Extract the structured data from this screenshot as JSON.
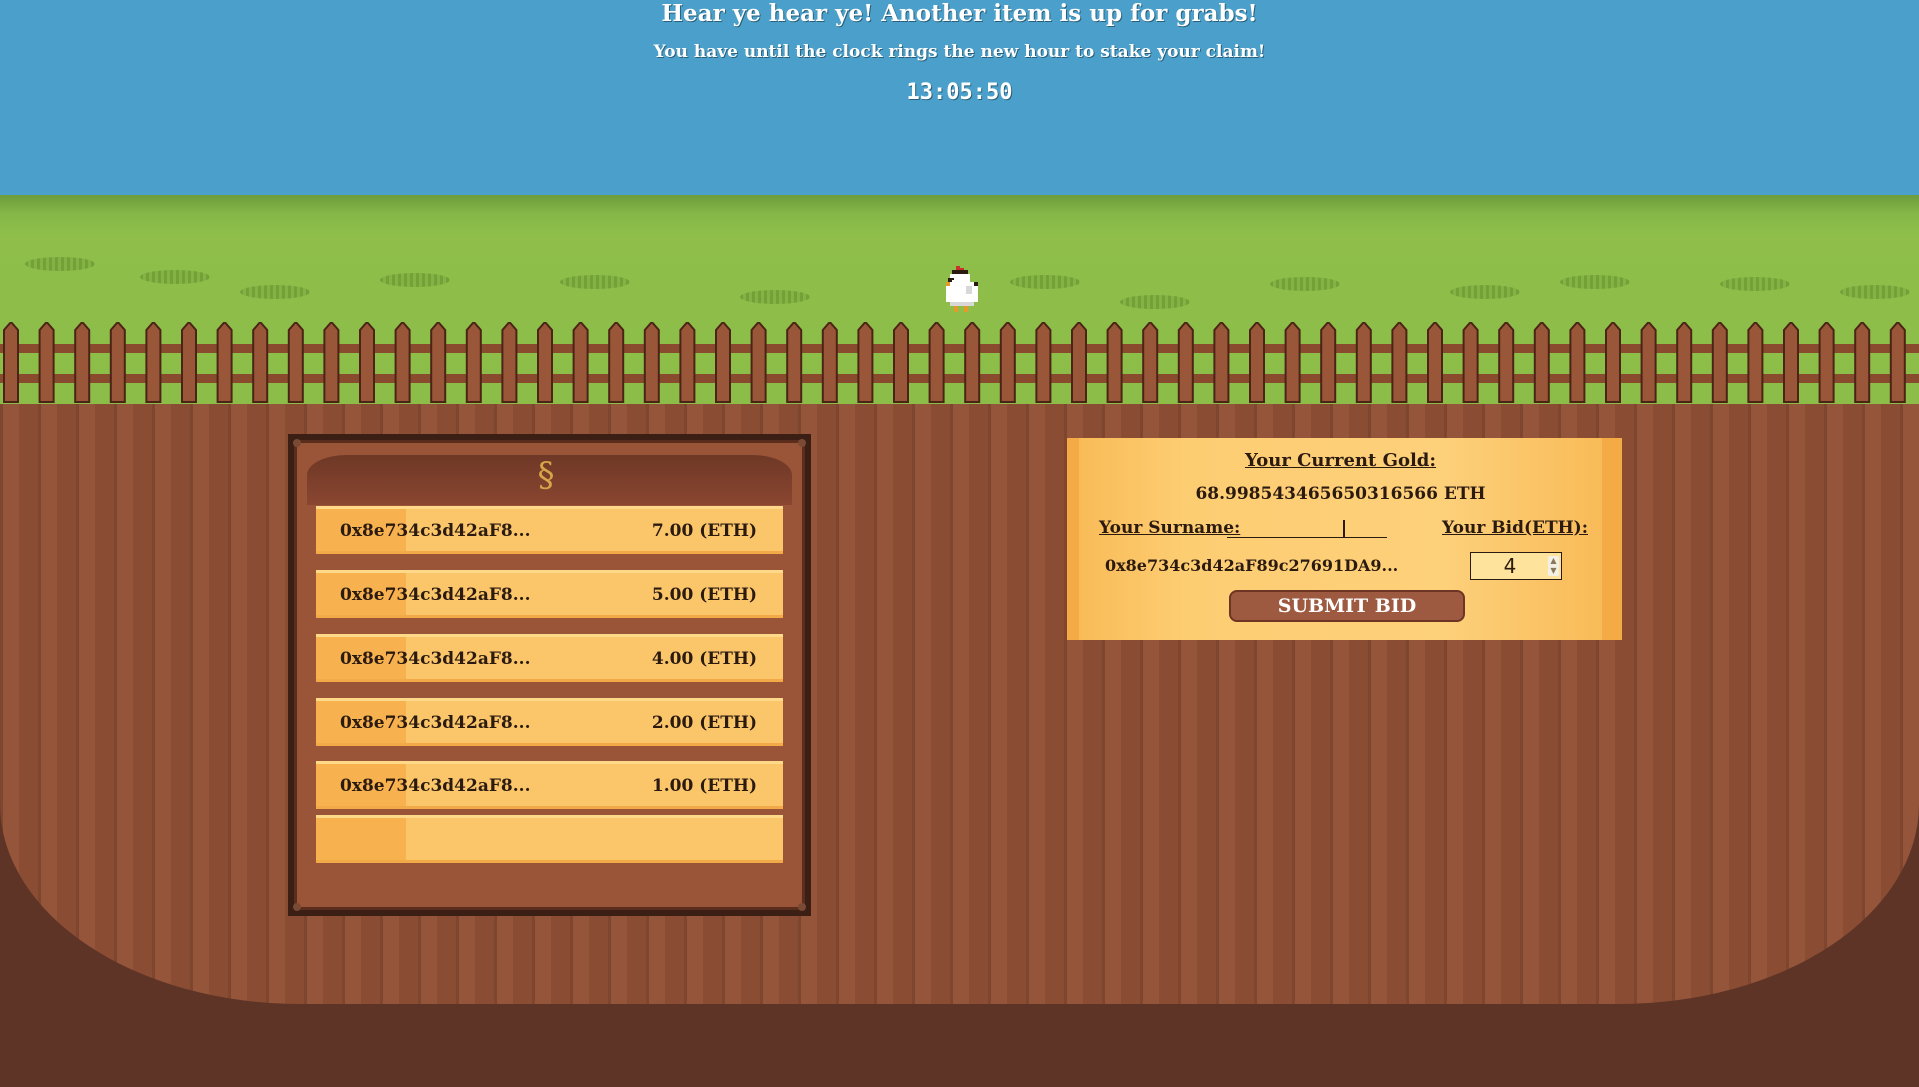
{
  "header": {
    "title": "Hear ye hear ye! Another item is up for grabs!",
    "subtitle": "You have until the clock rings the new hour to stake your claim!",
    "clock": "13:05:50"
  },
  "bids": [
    {
      "address": "0x8e734c3d42aF8...",
      "amount": "7.00 (ETH)"
    },
    {
      "address": "0x8e734c3d42aF8...",
      "amount": "5.00 (ETH)"
    },
    {
      "address": "0x8e734c3d42aF8...",
      "amount": "4.00 (ETH)"
    },
    {
      "address": "0x8e734c3d42aF8...",
      "amount": "2.00 (ETH)"
    },
    {
      "address": "0x8e734c3d42aF8...",
      "amount": "1.00 (ETH)"
    },
    {
      "address": "",
      "amount": ""
    }
  ],
  "panel": {
    "gold_label": "Your Current Gold:",
    "gold_value": "68.99854346565031656​6 ETH",
    "surname_label": "Your Surname:",
    "bid_label": "Your Bid(ETH):",
    "surname_value": "0x8e734c3d42aF89c27691DA9...",
    "bid_value": "4",
    "submit_label": "SUBMIT BID"
  },
  "colors": {
    "sky": "#4aa0ca",
    "grass": "#8cbd48",
    "dirt": "#94553a",
    "scroll": "#fcc56a",
    "button": "#9e5a40"
  },
  "icons": {
    "mascot": "chicken-icon",
    "board_ornament": "scroll-ornament-icon"
  }
}
